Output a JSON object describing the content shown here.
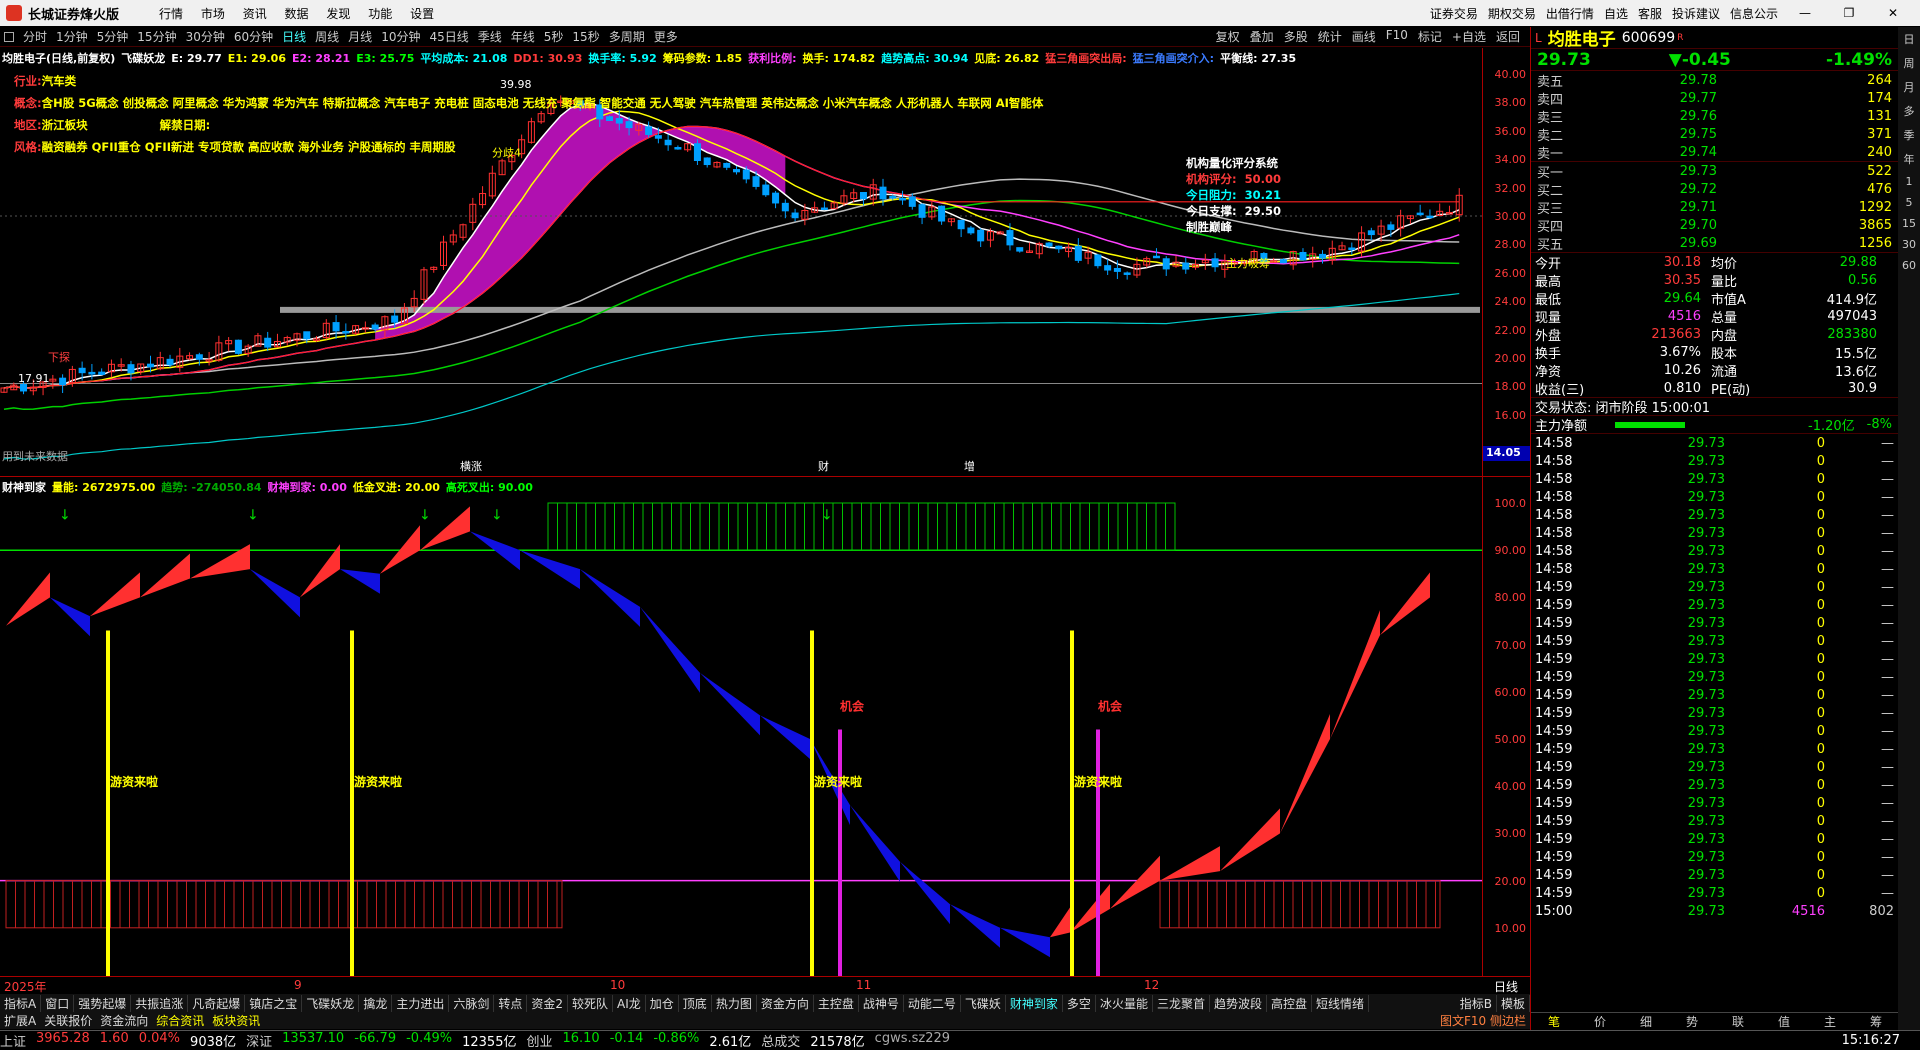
{
  "app": {
    "title": "长城证券烽火版",
    "menu": [
      "行情",
      "市场",
      "资讯",
      "数据",
      "发现",
      "功能",
      "设置"
    ],
    "right_links": [
      "证券交易",
      "期权交易",
      "出借行情",
      "自选",
      "客服",
      "投诉建议",
      "信息公示"
    ]
  },
  "periods": {
    "items": [
      "分时",
      "1分钟",
      "5分钟",
      "15分钟",
      "30分钟",
      "60分钟",
      "日线",
      "周线",
      "月线",
      "10分钟",
      "45日线",
      "季线",
      "年线",
      "5秒",
      "15秒",
      "多周期",
      "更多"
    ],
    "active": "日线",
    "tools": [
      "复权",
      "叠加",
      "多股",
      "统计",
      "画线",
      "F10",
      "标记",
      "+自选",
      "返回"
    ]
  },
  "main": {
    "indicator_line": [
      {
        "t": "均胜电子(日线,前复权)",
        "c": "#ffffff"
      },
      {
        "t": "飞碟妖龙",
        "c": "#ffffff"
      },
      {
        "t": "E: 29.77",
        "c": "#ffffff"
      },
      {
        "t": "E1: 29.06",
        "c": "#ffff00"
      },
      {
        "t": "E2: 28.21",
        "c": "#ff40ff"
      },
      {
        "t": "E3: 25.75",
        "c": "#00ff00"
      },
      {
        "t": "平均成本: 21.08",
        "c": "#00ffff"
      },
      {
        "t": "DD1: 30.93",
        "c": "#ff3b3b"
      },
      {
        "t": "换手率: 5.92",
        "c": "#00ffff"
      },
      {
        "t": "筹码参数: 1.85",
        "c": "#ffff00"
      },
      {
        "t": "获利比例:",
        "c": "#ff40ff"
      },
      {
        "t": "换手: 174.82",
        "c": "#ffff00"
      },
      {
        "t": "趋势高点: 30.94",
        "c": "#00ffff"
      },
      {
        "t": "见底: 26.82",
        "c": "#ffff00"
      },
      {
        "t": "猛三角画突出局:",
        "c": "#ff3b3b"
      },
      {
        "t": "猛三角画突介入:",
        "c": "#3b7bff"
      },
      {
        "t": "平衡线: 27.35",
        "c": "#ffffff"
      }
    ],
    "info_lines": [
      {
        "label": "行业:",
        "value": "汽车类"
      },
      {
        "label": "概念:",
        "value": "含H股 5G概念 创投概念 阿里概念 华为鸿蒙 华为汽车 特斯拉概念 汽车电子 充电桩 固态电池 无线充 聚氨酯 智能交通 无人驾驶 汽车热管理 英伟达概念 小米汽车概念 人形机器人 车联网 AI智能体"
      },
      {
        "label": "地区:",
        "value": "浙江板块",
        "extra": "解禁日期:"
      },
      {
        "label": "风格:",
        "value": "融资融券 QFII重仓 QFII新进 专项贷款 高应收款 海外业务 沪股通标的 丰周期股"
      }
    ],
    "quant": {
      "title": "机构量化评分系统",
      "rows": [
        {
          "k": "机构评分:",
          "v": "50.00",
          "c": "#ff3b3b"
        },
        {
          "k": "今日阻力:",
          "v": "30.21",
          "c": "#00ffff"
        },
        {
          "k": "今日支撑:",
          "v": "29.50",
          "c": "#ffffff"
        }
      ],
      "tail": "制胜巅峰"
    },
    "labels": {
      "xiadie": "下探",
      "price_hi": "39.98",
      "price_lo": "17.91",
      "fenzhi": "分歧4",
      "zhuli": "主力吸筹",
      "bottom": "用到未来数据",
      "events": [
        "横涨",
        "财",
        "增"
      ]
    },
    "axis": [
      "40.00",
      "38.00",
      "36.00",
      "34.00",
      "32.00",
      "30.00",
      "28.00",
      "26.00",
      "24.00",
      "22.00",
      "20.00",
      "18.00",
      "16.00"
    ],
    "axis_last": "14.05"
  },
  "sub": {
    "indicator_line": [
      {
        "t": "财神到家",
        "c": "#ffffff"
      },
      {
        "t": "量能: 2672975.00",
        "c": "#ffff00"
      },
      {
        "t": "趋势: -274050.84",
        "c": "#00aa00"
      },
      {
        "t": "财神到家: 0.00",
        "c": "#ff40ff"
      },
      {
        "t": "低金叉进: 20.00",
        "c": "#ffff00"
      },
      {
        "t": "高死叉出: 90.00",
        "c": "#00ff00"
      }
    ],
    "axis": [
      "100.0",
      "90.00",
      "80.00",
      "70.00",
      "60.00",
      "50.00",
      "40.00",
      "30.00",
      "20.00",
      "10.00"
    ],
    "youzi": "游资来啦",
    "jihui": "机会"
  },
  "dates": [
    "2025年",
    "9",
    "10",
    "11",
    "12"
  ],
  "dates_right": "日线",
  "tabs1": {
    "items": [
      "指标A",
      "窗口",
      "强势起爆",
      "共振追涨",
      "凡奇起爆",
      "镇店之宝",
      "飞碟妖龙",
      "擒龙",
      "主力进出",
      "六脉剑",
      "转点",
      "资金2",
      "较死队",
      "AI龙",
      "加仓",
      "顶底",
      "热力图",
      "资金方向",
      "主控盘",
      "战神号",
      "动能二号",
      "飞碟妖",
      "财神到家",
      "多空",
      "冰火量能",
      "三龙聚首",
      "趋势波段",
      "高控盘",
      "短线情绪"
    ],
    "active": "财神到家",
    "right": [
      "指标B",
      "模板"
    ]
  },
  "tabs2": {
    "items": [
      "扩展A",
      "关联报价",
      "资金流向",
      "综合资讯",
      "板块资讯"
    ],
    "active": [
      "综合资讯",
      "板块资讯"
    ],
    "right": "图文F10 侧边栏"
  },
  "status": [
    {
      "t": "上证",
      "c": "#ccc"
    },
    {
      "t": "3965.28",
      "c": "#ff3b3b"
    },
    {
      "t": "1.60",
      "c": "#ff3b3b"
    },
    {
      "t": "0.04%",
      "c": "#ff3b3b"
    },
    {
      "t": "9038亿",
      "c": "#fff"
    },
    {
      "t": "深证",
      "c": "#ccc"
    },
    {
      "t": "13537.10",
      "c": "#00e000"
    },
    {
      "t": "-66.79",
      "c": "#00e000"
    },
    {
      "t": "-0.49%",
      "c": "#00e000"
    },
    {
      "t": "12355亿",
      "c": "#fff"
    },
    {
      "t": "创业",
      "c": "#ccc"
    },
    {
      "t": "16.10",
      "c": "#00e000"
    },
    {
      "t": "-0.14",
      "c": "#00e000"
    },
    {
      "t": "-0.86%",
      "c": "#00e000"
    },
    {
      "t": "2.61亿",
      "c": "#fff"
    },
    {
      "t": "总成交",
      "c": "#ccc"
    },
    {
      "t": "21578亿",
      "c": "#fff"
    },
    {
      "t": "cgws.sz229",
      "c": "#aaa"
    }
  ],
  "clock": "15:16:27",
  "quote": {
    "name": "均胜电子",
    "code": "600699",
    "tag": "R",
    "price": "29.73",
    "change": "▼-0.45",
    "pct": "-1.49%",
    "asks": [
      {
        "k": "卖五",
        "p": "29.78",
        "v": "264"
      },
      {
        "k": "卖四",
        "p": "29.77",
        "v": "174"
      },
      {
        "k": "卖三",
        "p": "29.76",
        "v": "131"
      },
      {
        "k": "卖二",
        "p": "29.75",
        "v": "371"
      },
      {
        "k": "卖一",
        "p": "29.74",
        "v": "240"
      }
    ],
    "bids": [
      {
        "k": "买一",
        "p": "29.73",
        "v": "522"
      },
      {
        "k": "买二",
        "p": "29.72",
        "v": "476"
      },
      {
        "k": "买三",
        "p": "29.71",
        "v": "1292"
      },
      {
        "k": "买四",
        "p": "29.70",
        "v": "3865"
      },
      {
        "k": "买五",
        "p": "29.69",
        "v": "1256"
      }
    ],
    "stats": [
      [
        {
          "k": "今开",
          "v": "30.18",
          "c": "#ff3b3b"
        },
        {
          "k": "均价",
          "v": "29.88",
          "c": "#00e000"
        }
      ],
      [
        {
          "k": "最高",
          "v": "30.35",
          "c": "#ff3b3b"
        },
        {
          "k": "量比",
          "v": "0.56",
          "c": "#00e000"
        }
      ],
      [
        {
          "k": "最低",
          "v": "29.64",
          "c": "#00e000"
        },
        {
          "k": "市值A",
          "v": "414.9亿",
          "c": "#fff"
        }
      ],
      [
        {
          "k": "现量",
          "v": "4516",
          "c": "#ff40ff"
        },
        {
          "k": "总量",
          "v": "497043",
          "c": "#fff"
        }
      ],
      [
        {
          "k": "外盘",
          "v": "213663",
          "c": "#ff3b3b"
        },
        {
          "k": "内盘",
          "v": "283380",
          "c": "#00e000"
        }
      ],
      [
        {
          "k": "换手",
          "v": "3.67%",
          "c": "#fff"
        },
        {
          "k": "股本",
          "v": "15.5亿",
          "c": "#fff"
        }
      ],
      [
        {
          "k": "净资",
          "v": "10.26",
          "c": "#fff"
        },
        {
          "k": "流通",
          "v": "13.6亿",
          "c": "#fff"
        }
      ],
      [
        {
          "k": "收益(三)",
          "v": "0.810",
          "c": "#fff"
        },
        {
          "k": "PE(动)",
          "v": "30.9",
          "c": "#fff"
        }
      ]
    ],
    "trade_state": "交易状态: 闭市阶段 15:00:01",
    "netflow": {
      "k": "主力净额",
      "v": "-1.20亿",
      "p": "-8%"
    },
    "ticks": [
      {
        "t": "14:58",
        "p": "29.73",
        "v": "0"
      },
      {
        "t": "14:58",
        "p": "29.73",
        "v": "0"
      },
      {
        "t": "14:58",
        "p": "29.73",
        "v": "0"
      },
      {
        "t": "14:58",
        "p": "29.73",
        "v": "0"
      },
      {
        "t": "14:58",
        "p": "29.73",
        "v": "0"
      },
      {
        "t": "14:58",
        "p": "29.73",
        "v": "0"
      },
      {
        "t": "14:58",
        "p": "29.73",
        "v": "0"
      },
      {
        "t": "14:58",
        "p": "29.73",
        "v": "0"
      },
      {
        "t": "14:59",
        "p": "29.73",
        "v": "0"
      },
      {
        "t": "14:59",
        "p": "29.73",
        "v": "0"
      },
      {
        "t": "14:59",
        "p": "29.73",
        "v": "0"
      },
      {
        "t": "14:59",
        "p": "29.73",
        "v": "0"
      },
      {
        "t": "14:59",
        "p": "29.73",
        "v": "0"
      },
      {
        "t": "14:59",
        "p": "29.73",
        "v": "0"
      },
      {
        "t": "14:59",
        "p": "29.73",
        "v": "0"
      },
      {
        "t": "14:59",
        "p": "29.73",
        "v": "0"
      },
      {
        "t": "14:59",
        "p": "29.73",
        "v": "0"
      },
      {
        "t": "14:59",
        "p": "29.73",
        "v": "0"
      },
      {
        "t": "14:59",
        "p": "29.73",
        "v": "0"
      },
      {
        "t": "14:59",
        "p": "29.73",
        "v": "0"
      },
      {
        "t": "14:59",
        "p": "29.73",
        "v": "0"
      },
      {
        "t": "14:59",
        "p": "29.73",
        "v": "0"
      },
      {
        "t": "14:59",
        "p": "29.73",
        "v": "0"
      },
      {
        "t": "14:59",
        "p": "29.73",
        "v": "0"
      },
      {
        "t": "14:59",
        "p": "29.73",
        "v": "0"
      },
      {
        "t": "14:59",
        "p": "29.73",
        "v": "0"
      },
      {
        "t": "15:00",
        "p": "29.73",
        "v": "4516",
        "v2": "802"
      }
    ],
    "bottom_tabs": [
      "笔",
      "价",
      "细",
      "势",
      "联",
      "值",
      "主",
      "筹"
    ]
  },
  "side": [
    "日",
    "周",
    "月",
    "多",
    "季",
    "年",
    "1",
    "5",
    "15",
    "30",
    "60"
  ]
}
